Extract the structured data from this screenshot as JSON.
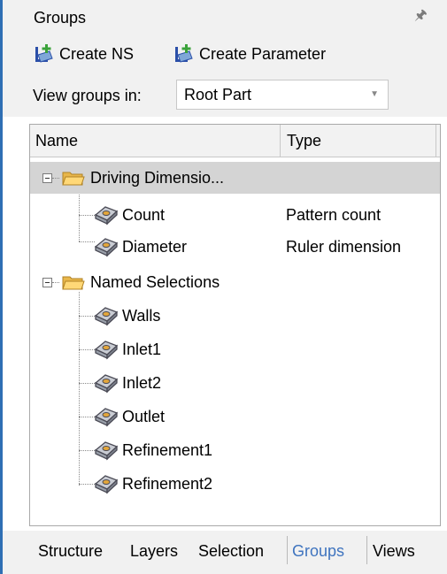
{
  "panel": {
    "title": "Groups",
    "pin_icon": "pin-icon"
  },
  "toolbar": {
    "create_ns": "Create NS",
    "create_parameter": "Create Parameter",
    "icon": "add-group-icon"
  },
  "view_groups": {
    "label": "View groups in:",
    "selected": "Root Part"
  },
  "tree": {
    "columns": {
      "name": "Name",
      "type": "Type"
    },
    "groups": [
      {
        "label": "Driving Dimensio...",
        "items": [
          {
            "name": "Count",
            "type": "Pattern count"
          },
          {
            "name": "Diameter",
            "type": "Ruler dimension"
          }
        ]
      },
      {
        "label": "Named Selections",
        "items": [
          {
            "name": "Walls",
            "type": ""
          },
          {
            "name": "Inlet1",
            "type": ""
          },
          {
            "name": "Inlet2",
            "type": ""
          },
          {
            "name": "Outlet",
            "type": ""
          },
          {
            "name": "Refinement1",
            "type": ""
          },
          {
            "name": "Refinement2",
            "type": ""
          }
        ]
      }
    ]
  },
  "tabs": [
    "Structure",
    "Layers",
    "Selection",
    "Groups",
    "Views"
  ],
  "active_tab": "Groups",
  "colors": {
    "accent_blue": "#3f74bf",
    "selected_row": "#d4d4d4",
    "panel_bg": "#f1f1f1"
  }
}
